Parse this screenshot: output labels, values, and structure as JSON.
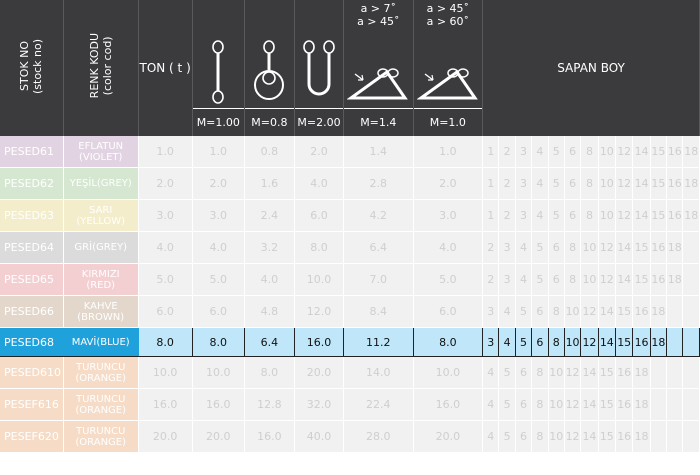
{
  "header": {
    "stok_no": "STOK NO",
    "stok_no_en": "(stock no)",
    "renk_kodu": "RENK KODU",
    "renk_kodu_en": "(color cod)",
    "ton": "TON ( t )",
    "sapan_boy": "SAPAN BOY",
    "angles": {
      "a1_line1": "a > 7˚",
      "a1_line2": "a > 45˚",
      "a2_line1": "a > 45˚",
      "a2_line2": "a > 60˚"
    },
    "m_values": [
      "M=1.00",
      "M=0.8",
      "M=2.00",
      "M=1.4",
      "M=1.0"
    ],
    "icons": [
      "straight-sling-icon",
      "choker-ring-sling-icon",
      "u-basket-sling-icon",
      "basket-angle-45-icon",
      "basket-angle-60-icon"
    ]
  },
  "rows": [
    {
      "stok": "PESED61",
      "color_line1": "EFLATUN",
      "color_line2": "(VIOLET)",
      "bg": "#d9c5da",
      "vals": [
        "1.0",
        "1.0",
        "0.8",
        "2.0",
        "1.4",
        "1.0"
      ],
      "lengths": [
        "1",
        "2",
        "3",
        "4",
        "5",
        "6",
        "8",
        "10",
        "12",
        "14",
        "15",
        "16",
        "18"
      ],
      "selected": false
    },
    {
      "stok": "PESED62",
      "color_line1": "YEŞİL(GREY)",
      "color_line2": "",
      "bg": "#c7dfc2",
      "vals": [
        "2.0",
        "2.0",
        "1.6",
        "4.0",
        "2.8",
        "2.0"
      ],
      "lengths": [
        "1",
        "2",
        "3",
        "4",
        "5",
        "6",
        "8",
        "10",
        "12",
        "14",
        "15",
        "16",
        "18"
      ],
      "selected": false
    },
    {
      "stok": "PESED63",
      "color_line1": "SARI",
      "color_line2": "(YELLOW)",
      "bg": "#efe7bb",
      "vals": [
        "3.0",
        "3.0",
        "2.4",
        "6.0",
        "4.2",
        "3.0"
      ],
      "lengths": [
        "1",
        "2",
        "3",
        "4",
        "5",
        "6",
        "8",
        "10",
        "12",
        "14",
        "15",
        "16",
        "18"
      ],
      "selected": false
    },
    {
      "stok": "PESED64",
      "color_line1": "GRİ(GREY)",
      "color_line2": "",
      "bg": "#cfcfcf",
      "vals": [
        "4.0",
        "4.0",
        "3.2",
        "8.0",
        "6.4",
        "4.0"
      ],
      "lengths": [
        "2",
        "3",
        "4",
        "5",
        "6",
        "8",
        "10",
        "12",
        "14",
        "15",
        "16",
        "18"
      ],
      "selected": false
    },
    {
      "stok": "PESED65",
      "color_line1": "KIRMIZI",
      "color_line2": "(RED)",
      "bg": "#efc0c4",
      "vals": [
        "5.0",
        "5.0",
        "4.0",
        "10.0",
        "7.0",
        "5.0"
      ],
      "lengths": [
        "2",
        "3",
        "4",
        "5",
        "6",
        "8",
        "10",
        "12",
        "14",
        "15",
        "16",
        "18"
      ],
      "selected": false
    },
    {
      "stok": "PESED66",
      "color_line1": "KAHVE",
      "color_line2": "(BROWN)",
      "bg": "#d9cab9",
      "vals": [
        "6.0",
        "6.0",
        "4.8",
        "12.0",
        "8.4",
        "6.0"
      ],
      "lengths": [
        "3",
        "4",
        "5",
        "6",
        "8",
        "10",
        "12",
        "14",
        "15",
        "16",
        "18"
      ],
      "selected": false
    },
    {
      "stok": "PESED68",
      "color_line1": "MAVİ(BLUE)",
      "color_line2": "",
      "bg": "#1fa2dc",
      "vals": [
        "8.0",
        "8.0",
        "6.4",
        "16.0",
        "11.2",
        "8.0"
      ],
      "lengths": [
        "3",
        "4",
        "5",
        "6",
        "8",
        "10",
        "12",
        "14",
        "15",
        "16",
        "18"
      ],
      "selected": true
    },
    {
      "stok": "PESED610",
      "color_line1": "TURUNCU",
      "color_line2": "(ORANGE)",
      "bg": "#f3d1b3",
      "vals": [
        "10.0",
        "10.0",
        "8.0",
        "20.0",
        "14.0",
        "10.0"
      ],
      "lengths": [
        "4",
        "5",
        "6",
        "8",
        "10",
        "12",
        "14",
        "15",
        "16",
        "18"
      ],
      "selected": false
    },
    {
      "stok": "PESEF616",
      "color_line1": "TURUNCU",
      "color_line2": "(ORANGE)",
      "bg": "#f3d1b3",
      "vals": [
        "16.0",
        "16.0",
        "12.8",
        "32.0",
        "22.4",
        "16.0"
      ],
      "lengths": [
        "4",
        "5",
        "6",
        "8",
        "10",
        "12",
        "14",
        "15",
        "16",
        "18"
      ],
      "selected": false
    },
    {
      "stok": "PESEF620",
      "color_line1": "TURUNCU",
      "color_line2": "(ORANGE)",
      "bg": "#f3d1b3",
      "vals": [
        "20.0",
        "20.0",
        "16.0",
        "40.0",
        "28.0",
        "20.0"
      ],
      "lengths": [
        "4",
        "5",
        "6",
        "8",
        "10",
        "12",
        "14",
        "15",
        "16",
        "18"
      ],
      "selected": false
    }
  ]
}
